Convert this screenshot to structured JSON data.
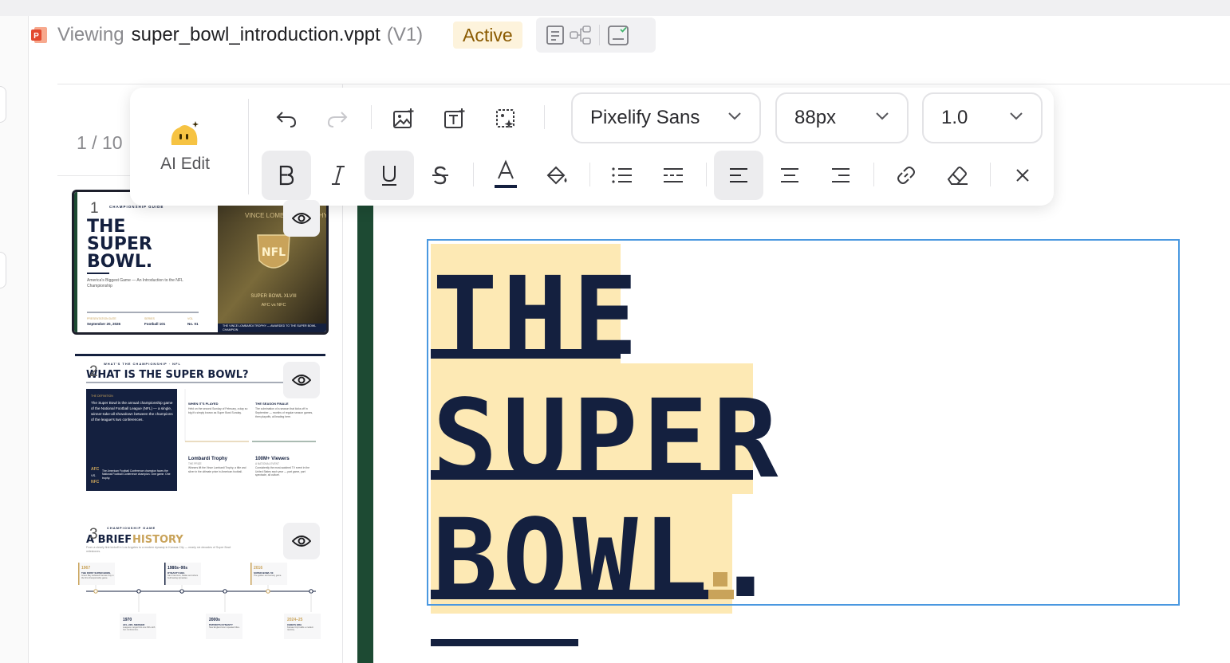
{
  "header": {
    "viewing_label": "Viewing",
    "filename": "super_bowl_introduction.vppt",
    "version": "(V1)",
    "status": "Active",
    "tools": [
      "document-icon",
      "flow-icon",
      "checklist-icon"
    ]
  },
  "toolbar": {
    "ai_edit_label": "AI Edit",
    "font_family": "Pixelify Sans",
    "font_size": "88px",
    "line_height": "1.0",
    "text_color": "#14203f",
    "active_buttons": [
      "bold",
      "underline",
      "align-left"
    ]
  },
  "sidebar": {
    "page_indicator": "1 / 10",
    "slides": [
      {
        "number": "1",
        "kicker": "CHAMPIONSHIP GUIDE",
        "title_lines": [
          "THE",
          "SUPER",
          "BOWL."
        ],
        "subtitle": "America's Biggest Game — An Introduction to the NFL Championship",
        "meta": [
          {
            "label": "PRESENTATION DATE",
            "value": "September 20, 2026"
          },
          {
            "label": "SERIES",
            "value": "Football 101"
          },
          {
            "label": "VOL",
            "value": "No. 01"
          }
        ],
        "photo_caption_top": "VINCE LOMBARDI TROPHY",
        "photo_caption_mid": "SUPER BOWL XLVIII",
        "photo_caption_sub": "AFC vs NFC",
        "photo_footer": "THE VINCE LOMBARDI TROPHY — AWARDED TO THE SUPER BOWL CHAMPION",
        "shield_text": "NFL"
      },
      {
        "number": "2",
        "kicker": "WHAT'S THE CHAMPIONSHIP · NFL",
        "title": "WHAT IS THE SUPER BOWL?",
        "definition_label": "THE DEFINITION",
        "definition": "The Super Bowl is the annual championship game of the National Football League (NFL) — a single, winner-take-all showdown between the champions of the league's two conferences.",
        "afc": "AFC",
        "vs": "VS.",
        "nfc": "NFC",
        "conf_note": "The American Football Conference champion faces the National Football Conference champion. One game. One trophy.",
        "cards": [
          {
            "title": "WHEN IT'S PLAYED",
            "body": "Held on the second Sunday of February, a day so big it's simply known as Super Bowl Sunday."
          },
          {
            "title": "THE SEASON FINALE",
            "body": "The culmination of a season that kicks off in September — months of regular season games, then playoffs, all leading here."
          },
          {
            "title": "Lombardi Trophy",
            "sub": "THE PRIZE",
            "body": "Winners lift the Vince Lombardi Trophy, a title and silver in the ultimate prize in American football."
          },
          {
            "title": "100M+ Viewers",
            "sub": "A NATIONAL EVENT",
            "body": "Consistently the most-watched TV event in the United States each year — part game, part spectacle, all culture."
          }
        ]
      },
      {
        "number": "3",
        "kicker": "CHAMPIONSHIP GAME",
        "title_a": "A BRIEF",
        "title_b": "HISTORY",
        "intro": "From a clearly first kickoff in Los Angeles to a modern dynasty in Kansas City — nearly six decades of Super Bowl milestones.",
        "events_top": [
          {
            "year": "1967",
            "label": "THE FIRST SUPER BOWL",
            "body": "Green Bay defeated Kansas City in the first championship game."
          },
          {
            "year": "1980s–90s",
            "label": "DYNASTY ERA",
            "body": "San Francisco, Dallas and others built lasting dynasties."
          },
          {
            "year": "2016",
            "label": "SUPER BOWL 50",
            "body": "The golden anniversary game."
          }
        ],
        "events_bottom": [
          {
            "year": "1970",
            "label": "AFL–NFL MERGER",
            "body": "Leagues merged into one NFL with two conferences."
          },
          {
            "year": "2000s",
            "label": "PATRIOTS DYNASTY",
            "body": "New England won repeated titles."
          },
          {
            "year": "2024–25",
            "label": "CHIEFS ERA",
            "body": "Kansas City builds a modern dynasty."
          }
        ]
      }
    ]
  },
  "slide": {
    "title_lines": [
      "THE",
      "SUPER",
      "BOWL."
    ],
    "title_color": "#14203f",
    "accent_color": "#c9a35a",
    "highlight_color": "#fde9b4",
    "selection_color": "#4a98e0"
  }
}
